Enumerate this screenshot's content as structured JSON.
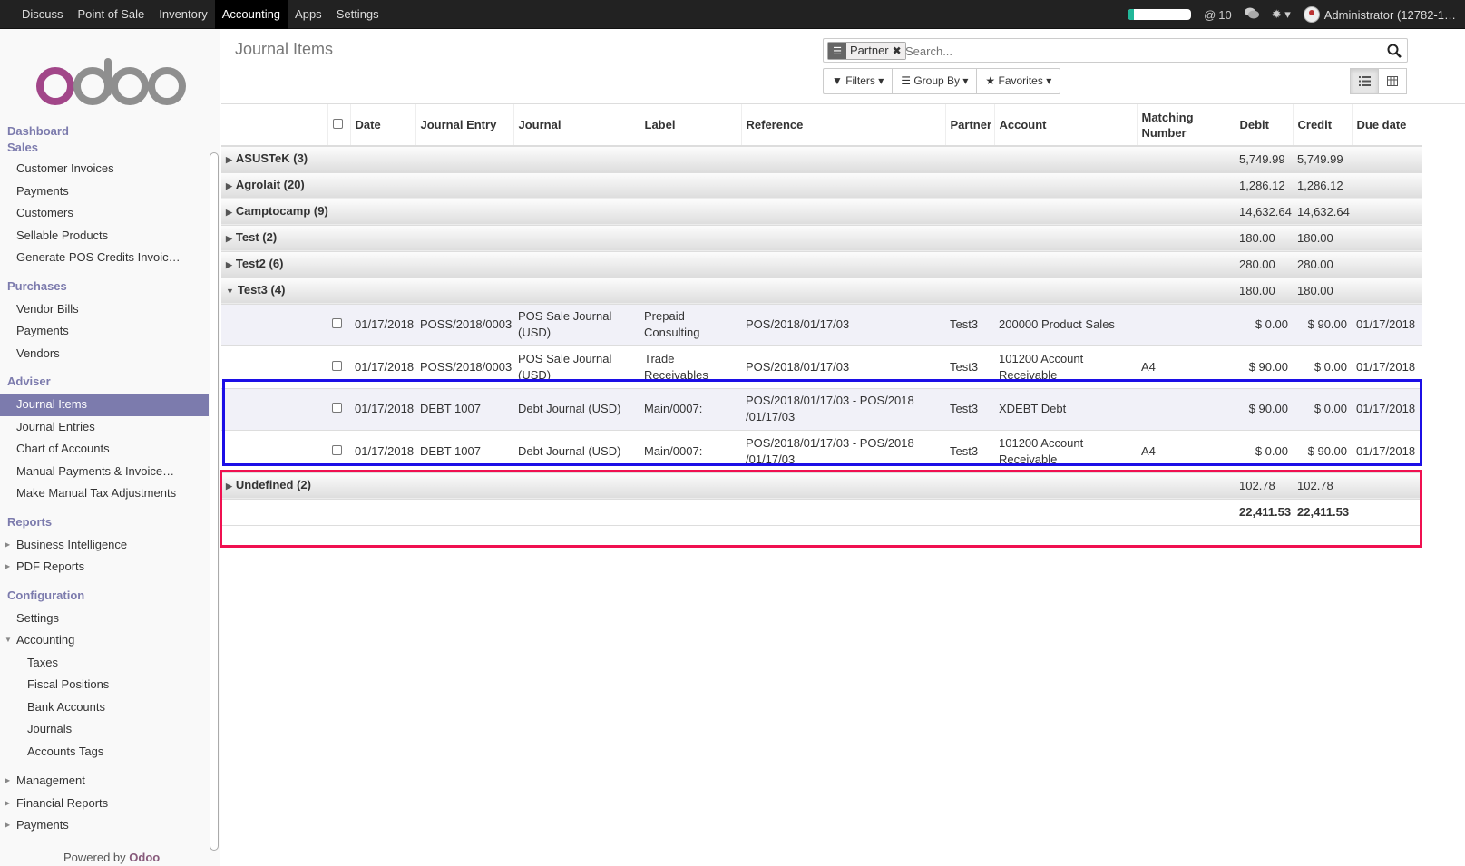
{
  "topbar": {
    "nav": [
      "Discuss",
      "Point of Sale",
      "Inventory",
      "Accounting",
      "Apps",
      "Settings"
    ],
    "active_nav": "Accounting",
    "mention_count": "10",
    "user": "Administrator (12782-1…",
    "progress_fraction": 0.1,
    "colors": {
      "bar": "#222222",
      "progress": "#21b799"
    }
  },
  "sidebar": {
    "logo_text": "odoo",
    "sections": [
      {
        "head": "Dashboard",
        "items": []
      },
      {
        "head": "Sales",
        "items": [
          "Customer Invoices",
          "Payments",
          "Customers",
          "Sellable Products",
          "Generate POS Credits Invoic…"
        ]
      },
      {
        "head": "Purchases",
        "items": [
          "Vendor Bills",
          "Payments",
          "Vendors"
        ]
      },
      {
        "head": "Adviser",
        "items": [
          "Journal Items",
          "Journal Entries",
          "Chart of Accounts",
          "Manual Payments & Invoice…",
          "Make Manual Tax Adjustments"
        ]
      },
      {
        "head": "Reports",
        "items": [
          "Business Intelligence",
          "PDF Reports"
        ]
      },
      {
        "head": "Configuration",
        "items": [
          "Settings",
          "Accounting",
          "Taxes",
          "Fiscal Positions",
          "Bank Accounts",
          "Journals",
          "Accounts Tags",
          "Management",
          "Financial Reports",
          "Payments"
        ]
      }
    ],
    "powered_by": "Powered by",
    "powered_brand": "Odoo",
    "accent": "#7c7bad"
  },
  "control_panel": {
    "title": "Journal Items",
    "facet_label": "Partner",
    "search_placeholder": "Search...",
    "filters": "Filters",
    "group_by": "Group By",
    "favorites": "Favorites"
  },
  "table": {
    "columns": [
      "Date",
      "Journal Entry",
      "Journal",
      "Label",
      "Reference",
      "Partner",
      "Account",
      "Matching Number",
      "Debit",
      "Credit",
      "Due date"
    ],
    "groups_before": [
      {
        "name": "ASUSTeK (3)",
        "debit": "5,749.99",
        "credit": "5,749.99"
      },
      {
        "name": "Agrolait (20)",
        "debit": "1,286.12",
        "credit": "1,286.12"
      },
      {
        "name": "Camptocamp (9)",
        "debit": "14,632.64",
        "credit": "14,632.64"
      },
      {
        "name": "Test (2)",
        "debit": "180.00",
        "credit": "180.00"
      },
      {
        "name": "Test2 (6)",
        "debit": "280.00",
        "credit": "280.00"
      }
    ],
    "open_group": {
      "name": "Test3 (4)",
      "debit": "180.00",
      "credit": "180.00"
    },
    "records": [
      {
        "date": "01/17/2018",
        "entry": "POSS/2018/0003",
        "journal": "POS Sale Journal (USD)",
        "label": "Prepaid Consulting",
        "reference": "POS/2018/01/17/03",
        "partner": "Test3",
        "account": "200000 Product Sales",
        "matching": "",
        "debit": "$ 0.00",
        "credit": "$ 90.00",
        "due": "01/17/2018"
      },
      {
        "date": "01/17/2018",
        "entry": "POSS/2018/0003",
        "journal": "POS Sale Journal (USD)",
        "label": "Trade Receivables",
        "reference": "POS/2018/01/17/03",
        "partner": "Test3",
        "account": "101200 Account Receivable",
        "matching": "A4",
        "debit": "$ 90.00",
        "credit": "$ 0.00",
        "due": "01/17/2018"
      },
      {
        "date": "01/17/2018",
        "entry": "DEBT 1007",
        "journal": "Debt Journal (USD)",
        "label": "Main/0007:",
        "reference": "POS/2018/01/17/03 - POS/2018 /01/17/03",
        "partner": "Test3",
        "account": "XDEBT Debt",
        "matching": "",
        "debit": "$ 90.00",
        "credit": "$ 0.00",
        "due": "01/17/2018"
      },
      {
        "date": "01/17/2018",
        "entry": "DEBT 1007",
        "journal": "Debt Journal (USD)",
        "label": "Main/0007:",
        "reference": "POS/2018/01/17/03 - POS/2018 /01/17/03",
        "partner": "Test3",
        "account": "101200 Account Receivable",
        "matching": "A4",
        "debit": "$ 0.00",
        "credit": "$ 90.00",
        "due": "01/17/2018"
      }
    ],
    "groups_after": [
      {
        "name": "Undefined (2)",
        "debit": "102.78",
        "credit": "102.78"
      }
    ],
    "total": {
      "debit": "22,411.53",
      "credit": "22,411.53"
    },
    "highlight_colors": {
      "blue": "#1c0fe6",
      "red": "#f01050"
    }
  }
}
